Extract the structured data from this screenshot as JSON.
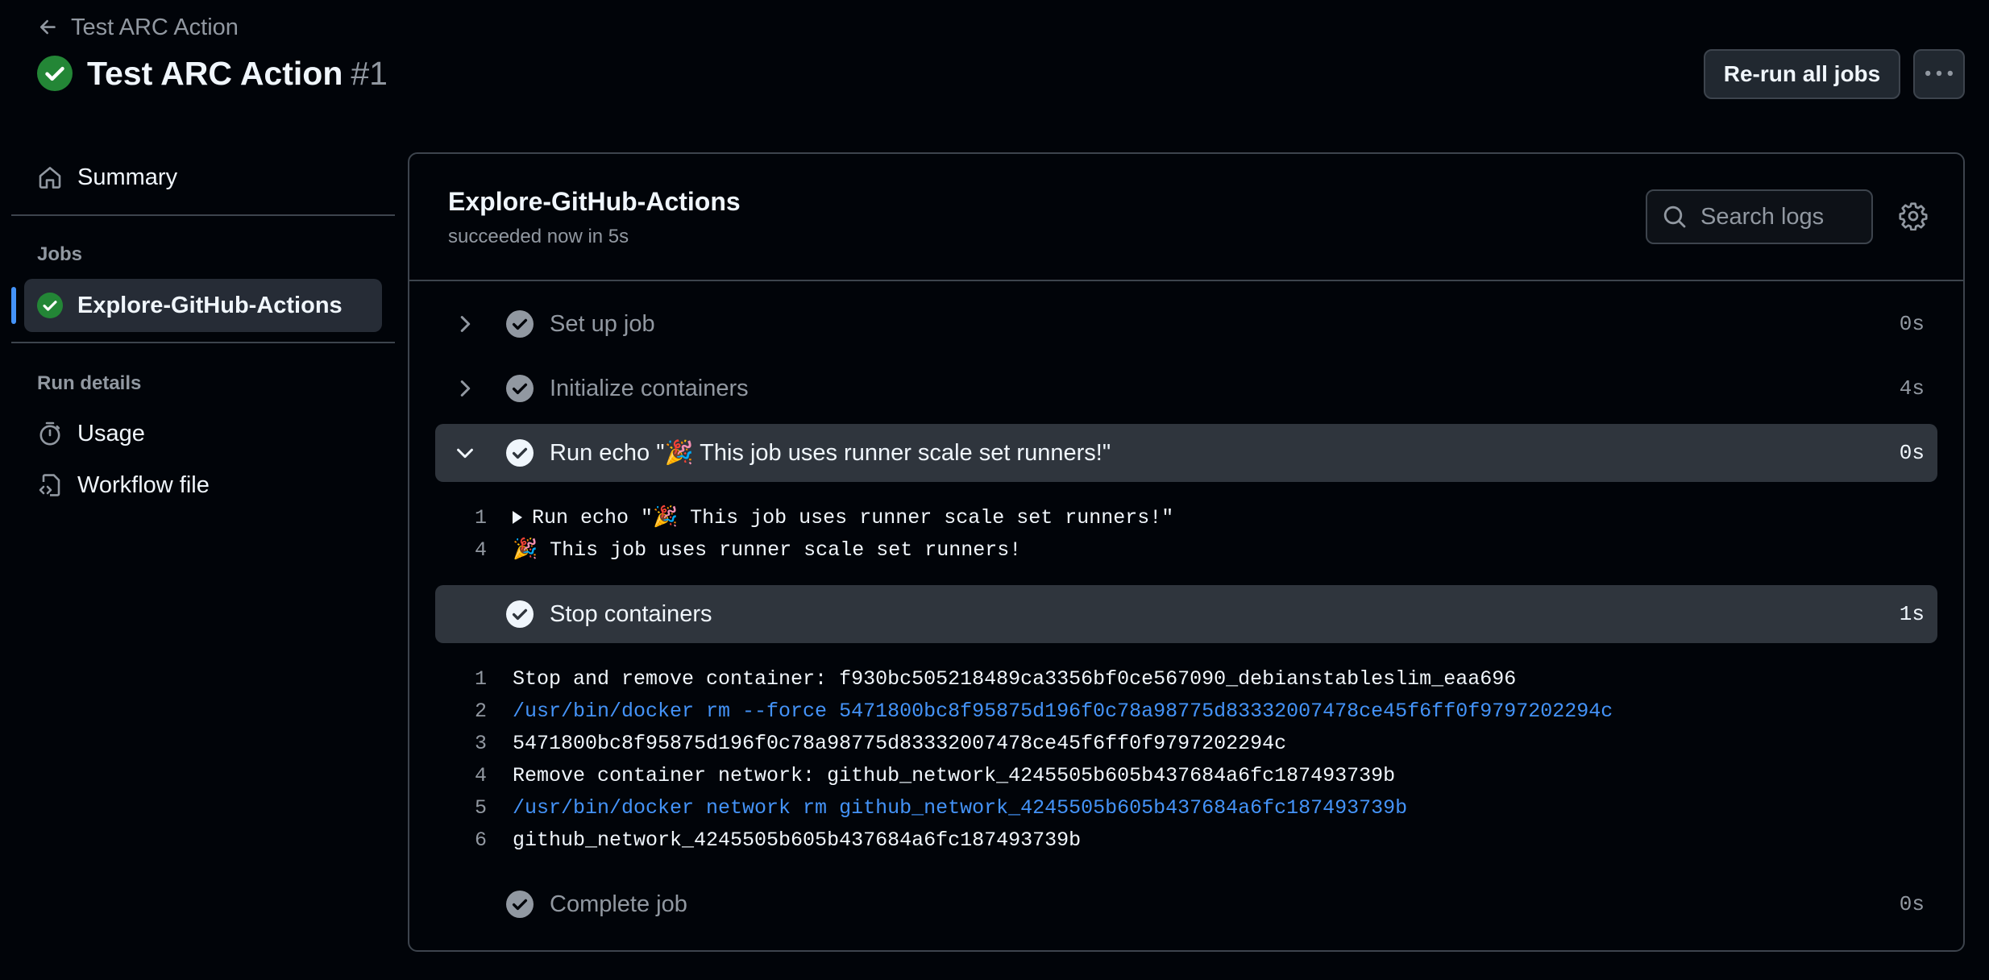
{
  "header": {
    "back_label": "Test ARC Action",
    "title": "Test ARC Action",
    "run_number": "#1",
    "rerun_label": "Re-run all jobs"
  },
  "sidebar": {
    "summary_label": "Summary",
    "jobs_heading": "Jobs",
    "job_label": "Explore-GitHub-Actions",
    "run_details_heading": "Run details",
    "usage_label": "Usage",
    "workflow_file_label": "Workflow file"
  },
  "job": {
    "title": "Explore-GitHub-Actions",
    "subtitle": "succeeded now in 5s",
    "search_placeholder": "Search logs"
  },
  "steps": [
    {
      "label": "Set up job",
      "duration": "0s"
    },
    {
      "label": "Initialize containers",
      "duration": "4s"
    },
    {
      "label": "Run echo \"🎉 This job uses runner scale set runners!\"",
      "duration": "0s"
    },
    {
      "label": "Stop containers",
      "duration": "1s"
    },
    {
      "label": "Complete job",
      "duration": "0s"
    }
  ],
  "logs_run_echo": [
    {
      "num": "1",
      "text": "Run echo \"🎉 This job uses runner scale set runners!\""
    },
    {
      "num": "4",
      "text": "🎉 This job uses runner scale set runners!"
    }
  ],
  "logs_stop": [
    {
      "num": "1",
      "text": "Stop and remove container: f930bc505218489ca3356bf0ce567090_debianstableslim_eaa696"
    },
    {
      "num": "2",
      "text": "/usr/bin/docker rm --force 5471800bc8f95875d196f0c78a98775d83332007478ce45f6ff0f9797202294c"
    },
    {
      "num": "3",
      "text": "5471800bc8f95875d196f0c78a98775d83332007478ce45f6ff0f9797202294c"
    },
    {
      "num": "4",
      "text": "Remove container network: github_network_4245505b605b437684a6fc187493739b"
    },
    {
      "num": "5",
      "text": "/usr/bin/docker network rm github_network_4245505b605b437684a6fc187493739b"
    },
    {
      "num": "6",
      "text": "github_network_4245505b605b437684a6fc187493739b"
    }
  ],
  "colors": {
    "success": "#238636",
    "accent": "#4493f8",
    "muted": "#9198a1",
    "background": "#010409"
  }
}
